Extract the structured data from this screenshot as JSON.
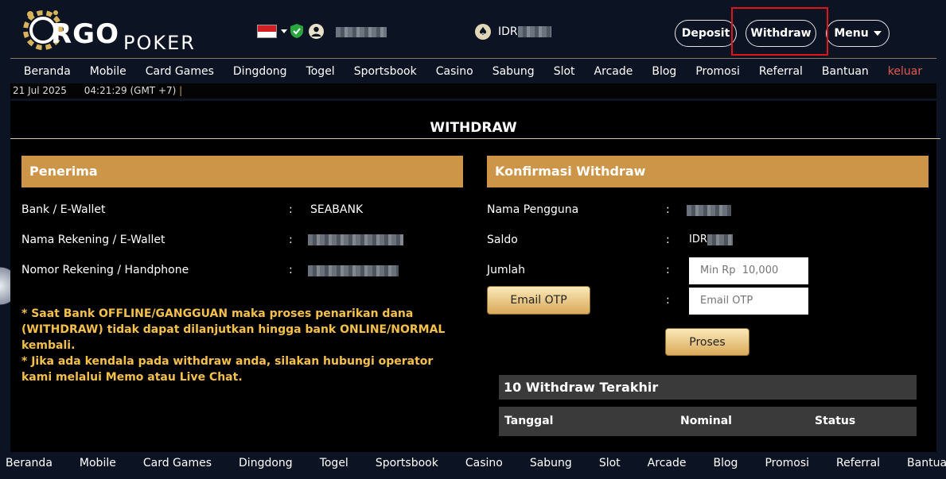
{
  "header": {
    "logo_main": "RGO",
    "logo_sub": "POKER",
    "flag": "indonesia-flag",
    "currency": "IDR",
    "buttons": {
      "deposit": "Deposit",
      "withdraw": "Withdraw",
      "menu": "Menu"
    }
  },
  "nav": {
    "items": [
      "Beranda",
      "Mobile",
      "Card Games",
      "Dingdong",
      "Togel",
      "Sportsbook",
      "Casino",
      "Sabung",
      "Slot",
      "Arcade",
      "Blog",
      "Promosi",
      "Referral",
      "Bantuan"
    ],
    "logout": "keluar"
  },
  "datebar": {
    "date": "21 Jul 2025",
    "time": "04:21:29 (GMT +7)",
    "cursor": "|"
  },
  "page": {
    "title": "WITHDRAW"
  },
  "penerima": {
    "title": "Penerima",
    "rows": [
      {
        "label": "Bank / E-Wallet",
        "colon": ":",
        "value": "SEABANK"
      },
      {
        "label": "Nama Rekening / E-Wallet",
        "colon": ":",
        "value": ""
      },
      {
        "label": "Nomor Rekening / Handphone",
        "colon": ":",
        "value": ""
      }
    ],
    "note": "* Saat Bank OFFLINE/GANGGUAN maka proses penarikan dana (WITHDRAW) tidak dapat dilanjutkan hingga bank ONLINE/NORMAL kembali.\n* Jika ada kendala pada withdraw anda, silakan hubungi operator kami melalui Memo atau Live Chat."
  },
  "konfirmasi": {
    "title": "Konfirmasi Withdraw",
    "rows": [
      {
        "label": "Nama Pengguna",
        "colon": ":"
      },
      {
        "label": "Saldo",
        "colon": ":",
        "value": "IDR"
      },
      {
        "label": "Jumlah",
        "colon": ":"
      }
    ],
    "amount_placeholder": "Min Rp  10,000",
    "otp_placeholder": "Email OTP",
    "otp_button": "Email OTP",
    "otp_colon": ":",
    "submit": "Proses"
  },
  "history": {
    "title": "10 Withdraw Terakhir",
    "columns": [
      "Tanggal",
      "Nominal",
      "Status"
    ]
  },
  "bottom_nav": {
    "items": [
      "Beranda",
      "Mobile",
      "Card Games",
      "Dingdong",
      "Togel",
      "Sportsbook",
      "Casino",
      "Sabung",
      "Slot",
      "Arcade",
      "Blog",
      "Promosi",
      "Referral",
      "Bantuan"
    ]
  },
  "colors": {
    "accent": "#cd9548",
    "note": "#f5c04a",
    "logout": "#e05a4e",
    "highlight": "#e0141c"
  }
}
